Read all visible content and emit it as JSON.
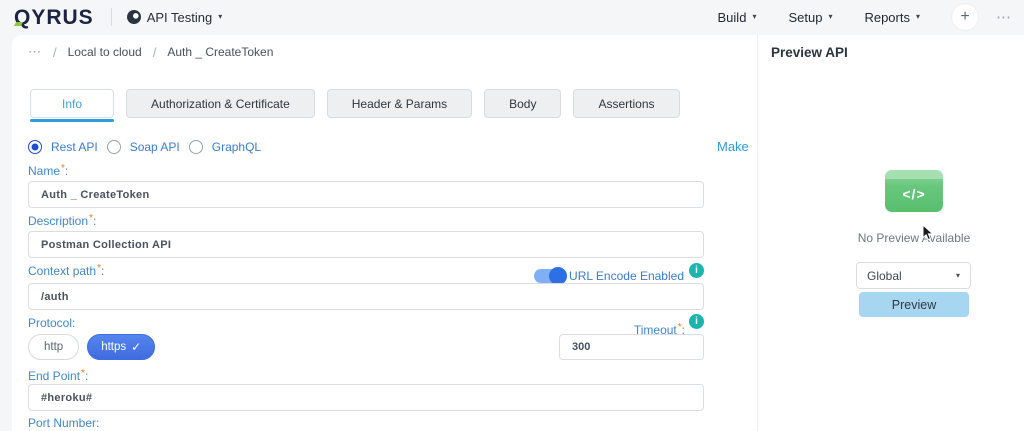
{
  "topbar": {
    "logo": "QYRUS",
    "app_switcher": {
      "label": "API Testing"
    },
    "nav": [
      {
        "label": "Build"
      },
      {
        "label": "Setup"
      },
      {
        "label": "Reports"
      }
    ]
  },
  "breadcrumb": {
    "items": [
      "Local to cloud",
      "Auth _ CreateToken"
    ]
  },
  "tabs": {
    "active": "Info",
    "items": [
      {
        "label": "Info"
      },
      {
        "label": "Authorization & Certificate"
      },
      {
        "label": "Header & Params"
      },
      {
        "label": "Body"
      },
      {
        "label": "Assertions"
      }
    ]
  },
  "api_type": {
    "selected": "Rest API",
    "options": [
      {
        "label": "Rest API"
      },
      {
        "label": "Soap API"
      },
      {
        "label": "GraphQL"
      }
    ]
  },
  "fields": {
    "name": {
      "label": "Name",
      "value": "Auth _ CreateToken",
      "required": true
    },
    "description": {
      "label": "Description",
      "value": "Postman Collection API",
      "required": true
    },
    "context_path": {
      "label": "Context path",
      "value": "/auth",
      "required": true
    },
    "url_encode": {
      "label": "URL Encode Enabled",
      "enabled": true
    },
    "protocol": {
      "label": "Protocol",
      "selected": "https",
      "options": [
        {
          "label": "http"
        },
        {
          "label": "https"
        }
      ]
    },
    "timeout": {
      "label": "Timeout",
      "value": "300",
      "required": true
    },
    "endpoint": {
      "label": "End Point",
      "value": "#heroku#",
      "required": true
    },
    "port": {
      "label": "Port Number"
    }
  },
  "make_link": {
    "label": "Make"
  },
  "preview_panel": {
    "title": "Preview API",
    "empty_text": "No Preview Available",
    "scope_select": {
      "value": "Global"
    },
    "preview_button": {
      "label": "Preview"
    }
  },
  "icons": {
    "code_glyph": "</>",
    "info_glyph": "i",
    "check_glyph": "✓",
    "plus_glyph": "+",
    "more_glyph": "⋯",
    "ellipsis_glyph": "⋯",
    "caret_glyph": "▾",
    "slash": "/",
    "asterisk": "*",
    "colon": ":"
  },
  "colors": {
    "accent_blue": "#2d9cdb",
    "label_blue": "#4186cc",
    "radio_blue": "#1d4ecb",
    "pill_blue": "#4b7be8",
    "toggle_blue": "#2f6fe4",
    "info_teal": "#1ab5ad",
    "icon_green": "#67c77c",
    "preview_button_bg": "#a7d6f1",
    "asterisk_orange": "#f27a24"
  }
}
